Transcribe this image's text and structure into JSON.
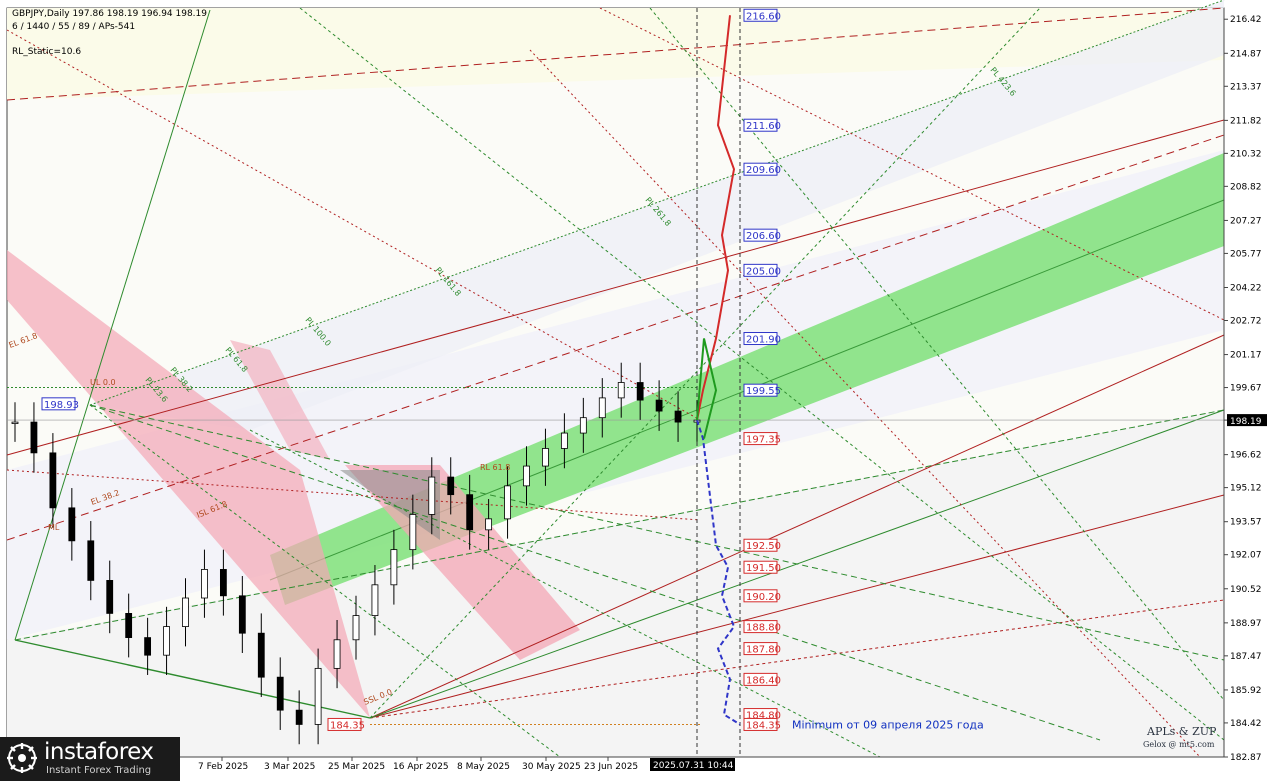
{
  "header": {
    "symbol_line": "GBPJPY,Daily 197.86 198.19 196.94 198.19",
    "params_line": "6 / 1440 / 55 / 89 / APs-541",
    "static_line": "RL_Static=10.6"
  },
  "watermark": {
    "title": "APLs & ZUP",
    "site": "Gelox @ mt5.com"
  },
  "logo": {
    "name": "instaforex",
    "tagline": "Instant Forex Trading"
  },
  "colors": {
    "green_band": "#7fe07a",
    "pink_band": "#f4a7b5",
    "target_up": "#2f35c8",
    "target_down": "#d42a2a",
    "bg": "#ffffff"
  },
  "chart_data": {
    "type": "line",
    "title": "GBPJPY,Daily",
    "ylim": [
      182.87,
      216.93
    ],
    "y_ticks": [
      "216.42",
      "214.87",
      "213.37",
      "211.82",
      "210.32",
      "208.82",
      "207.27",
      "205.77",
      "204.22",
      "202.72",
      "201.17",
      "199.67",
      "198.19",
      "196.62",
      "195.12",
      "193.57",
      "192.07",
      "190.52",
      "188.97",
      "187.47",
      "185.92",
      "184.42",
      "182.87"
    ],
    "current_price": "198.19",
    "x_ticks": [
      "7 Feb 2025",
      "3 Mar 2025",
      "25 Mar 2025",
      "16 Apr 2025",
      "8 May 2025",
      "30 May 2025",
      "23 Jun 2025",
      "2025.07.31 10:44"
    ],
    "price_path": [
      198.1,
      196.7,
      194.2,
      192.7,
      190.9,
      189.4,
      188.3,
      187.5,
      188.8,
      190.1,
      191.4,
      190.2,
      188.5,
      186.5,
      185.0,
      184.35,
      186.9,
      188.2,
      189.3,
      190.7,
      192.3,
      193.9,
      195.6,
      194.8,
      193.2,
      193.7,
      195.2,
      196.1,
      196.9,
      197.6,
      198.3,
      199.2,
      199.9,
      199.1,
      198.6,
      198.1,
      198.19
    ],
    "up_levels": [
      "216.60",
      "211.60",
      "209.60",
      "206.60",
      "205.00",
      "201.90",
      "199.55"
    ],
    "down_levels": [
      "197.35",
      "192.50",
      "191.50",
      "190.20",
      "188.80",
      "187.80",
      "186.40",
      "184.80",
      "184.35"
    ],
    "pivot_labels": [
      "198.93",
      "184.35"
    ],
    "fib_labels": [
      "PL 423.6",
      "PL 261.8",
      "PL 161.8",
      "PL 100.0",
      "PL 61.8",
      "PL 38.2",
      "PL 23.6",
      "ISL 61.8",
      "SSL 0.0",
      "EL 61.8",
      "EL 38.2",
      "ML",
      "RL 61.8",
      "UL 0.0"
    ],
    "annotation": "Minimum от 09 апреля 2025 года"
  }
}
